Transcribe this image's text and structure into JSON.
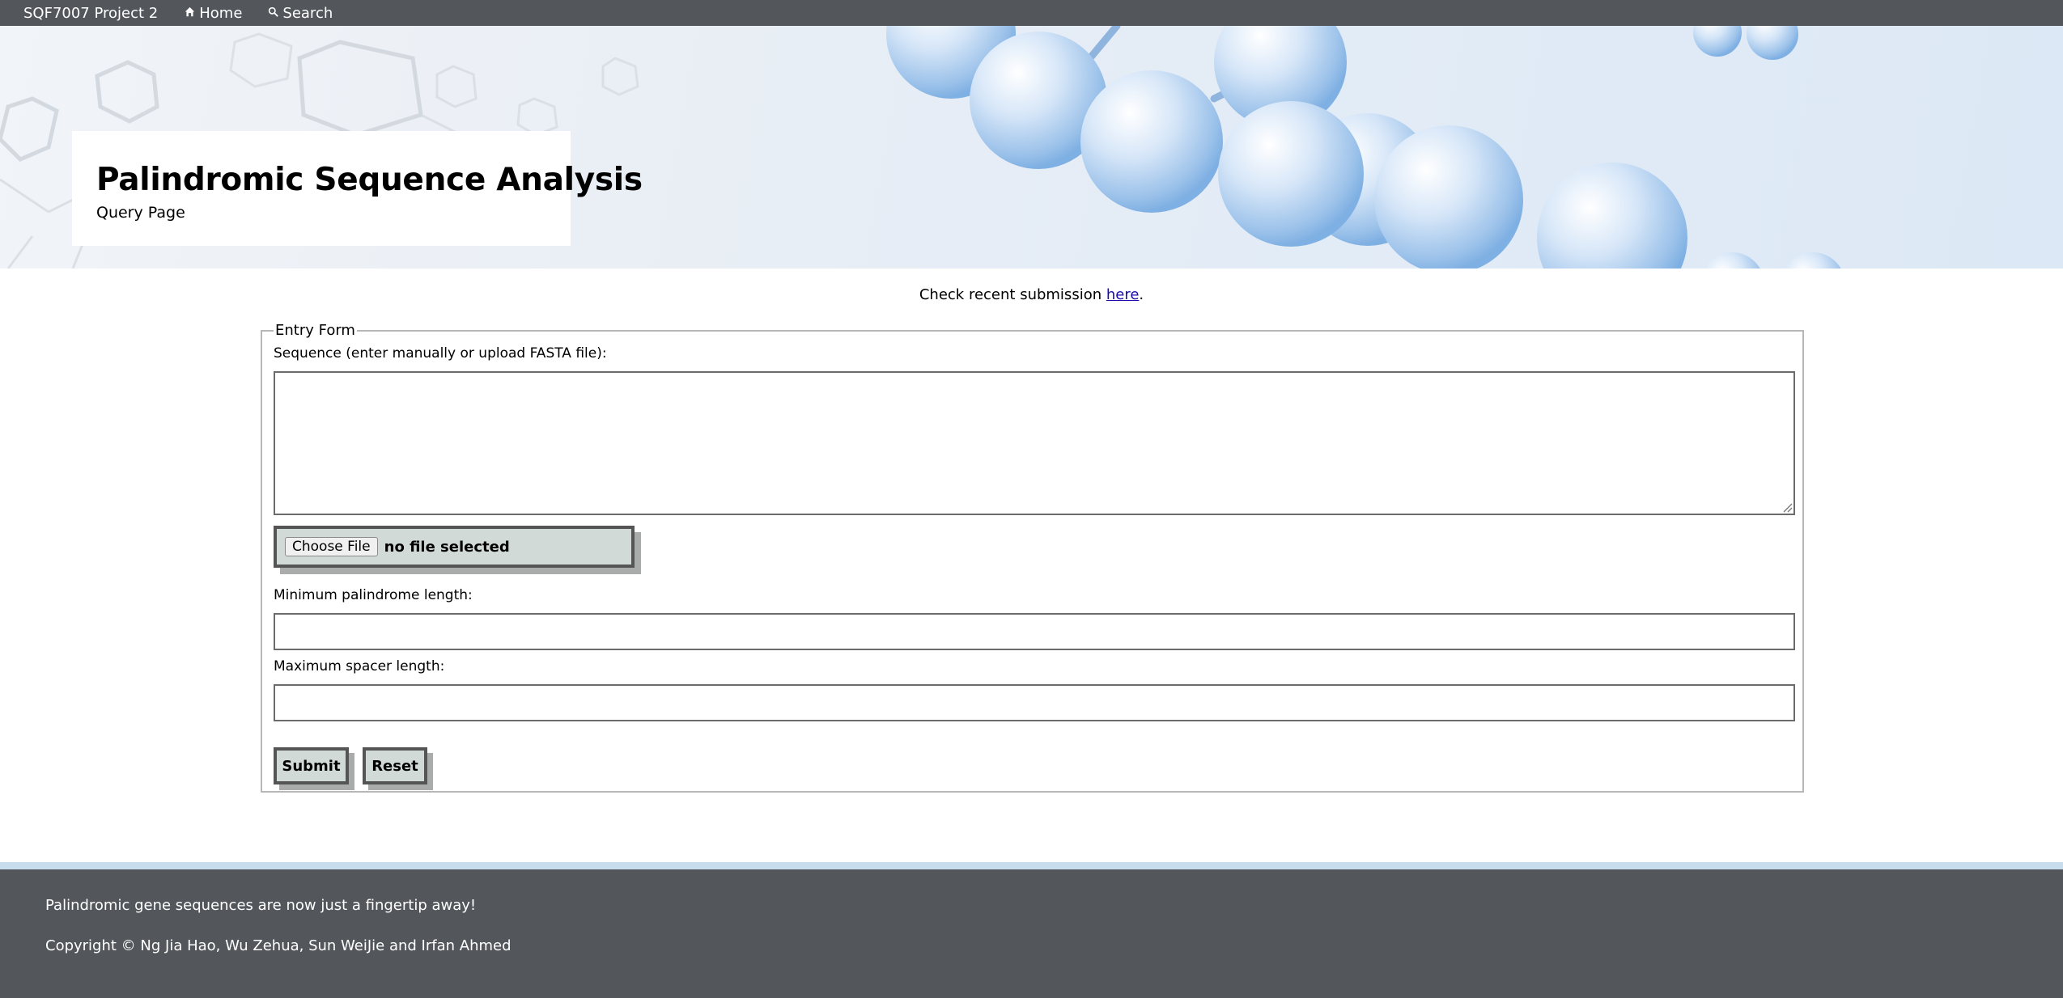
{
  "nav": {
    "brand": "SQF7007 Project 2",
    "home_label": "Home",
    "search_label": "Search"
  },
  "header": {
    "title": "Palindromic Sequence Analysis",
    "subtitle": "Query Page"
  },
  "recent": {
    "text": "Check recent submission ",
    "link_label": "here",
    "suffix": "."
  },
  "form": {
    "legend": "Entry Form",
    "sequence_label": "Sequence (enter manually or upload FASTA file):",
    "sequence_value": "",
    "file_button_label": "Choose File",
    "file_status": "no file selected",
    "min_len_label": "Minimum palindrome length:",
    "min_len_value": "",
    "max_spacer_label": "Maximum spacer length:",
    "max_spacer_value": "",
    "submit_label": "Submit",
    "reset_label": "Reset"
  },
  "footer": {
    "tagline": "Palindromic gene sequences are now just a fingertip away!",
    "copyright": "Copyright © Ng Jia Hao, Wu Zehua, Sun WeiJie and Irfan Ahmed"
  },
  "colors": {
    "nav_bg": "#53575b",
    "footer_bg": "#53575b",
    "footer_accent": "#c7dced",
    "button_bg": "#d2dad8",
    "link": "#1a0dab"
  }
}
